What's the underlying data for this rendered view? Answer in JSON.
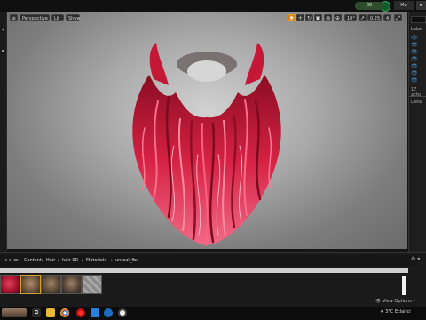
{
  "viewport": {
    "perspective_label": "Perspective",
    "lit_label": "Lit",
    "show_label": "Show",
    "camera_speed": "10°",
    "grid_snap": "0.25",
    "layer_count": "4"
  },
  "outliner": {
    "label_header": "Label",
    "item_count": "17 acto",
    "details_tab": "Deta"
  },
  "content_browser": {
    "breadcrumb": [
      "Content",
      "Hair",
      "hair-3D",
      "Materials",
      "unreal_fbx"
    ],
    "view_options": "View Options"
  },
  "taskbar": {
    "tray_text": "3°C Eclairci"
  },
  "top": {
    "fps": "60",
    "mode_button": "Ma"
  },
  "colors": {
    "accent": "#d07a12",
    "hair_base": "#c81e3c",
    "hair_highlight": "#ff5a78"
  }
}
